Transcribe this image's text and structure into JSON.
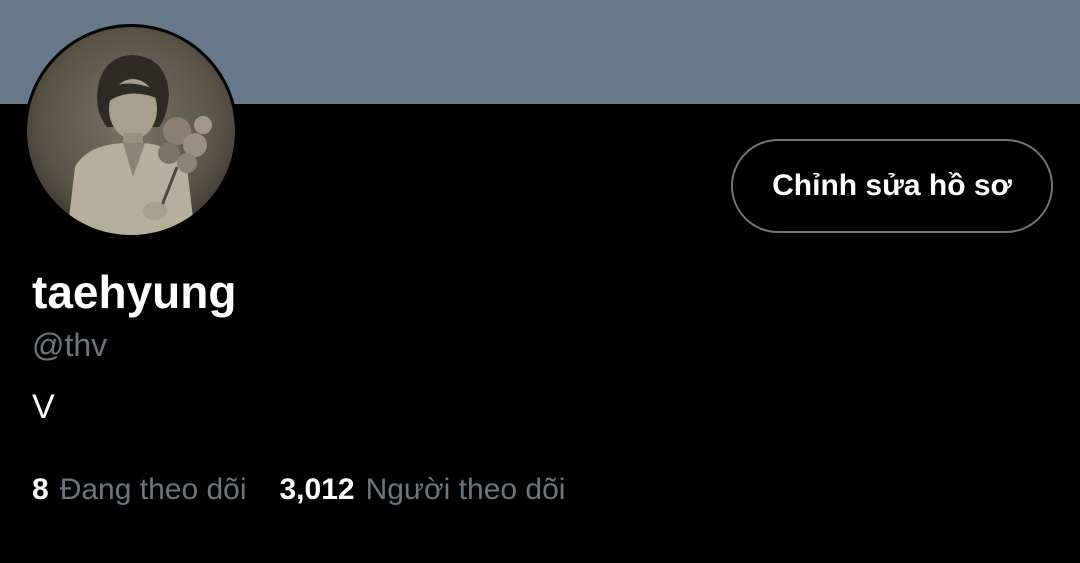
{
  "profile": {
    "display_name": "taehyung",
    "handle": "@thv",
    "bio": "V",
    "edit_button_label": "Chỉnh sửa hồ sơ",
    "following_count": "8",
    "following_label": "Đang theo dõi",
    "followers_count": "3,012",
    "followers_label": "Người theo dõi"
  },
  "colors": {
    "banner": "#66798b",
    "background": "#000000",
    "secondary_text": "#6e767d",
    "primary_text": "#ffffff"
  }
}
